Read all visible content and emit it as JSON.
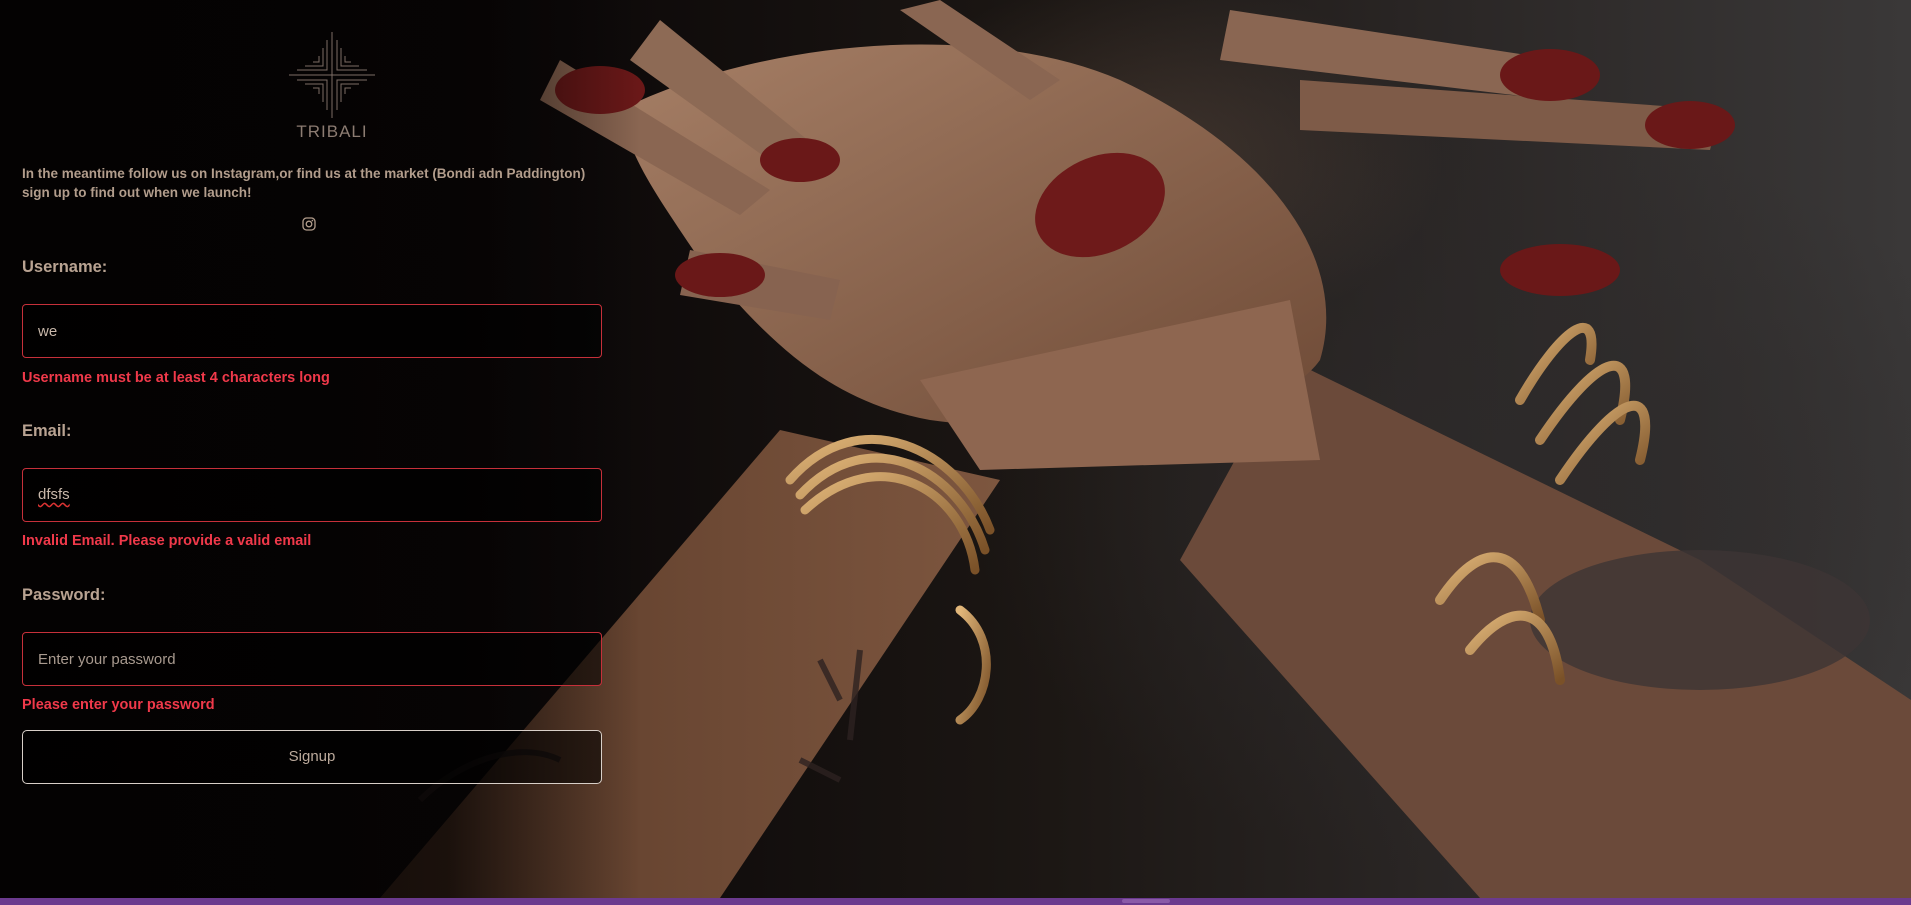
{
  "brand": {
    "name": "TRIBALI"
  },
  "intro_text": "In the meantime follow us on Instagram,or find us at the market (Bondi adn Paddington) sign up to find out when we launch!",
  "social": {
    "icon": "instagram-icon"
  },
  "form": {
    "username": {
      "label": "Username:",
      "value": "we",
      "error": "Username must be at least 4 characters long"
    },
    "email": {
      "label": "Email:",
      "value": "dfsfs",
      "error": "Invalid Email. Please provide a valid email"
    },
    "password": {
      "label": "Password:",
      "placeholder": "Enter your password",
      "error": "Please enter your password"
    },
    "submit_label": "Signup"
  },
  "colors": {
    "error": "#f0394a",
    "input_border_error": "#c6303a",
    "label": "#b9a392",
    "bottom_bar": "#6b3a8e"
  }
}
